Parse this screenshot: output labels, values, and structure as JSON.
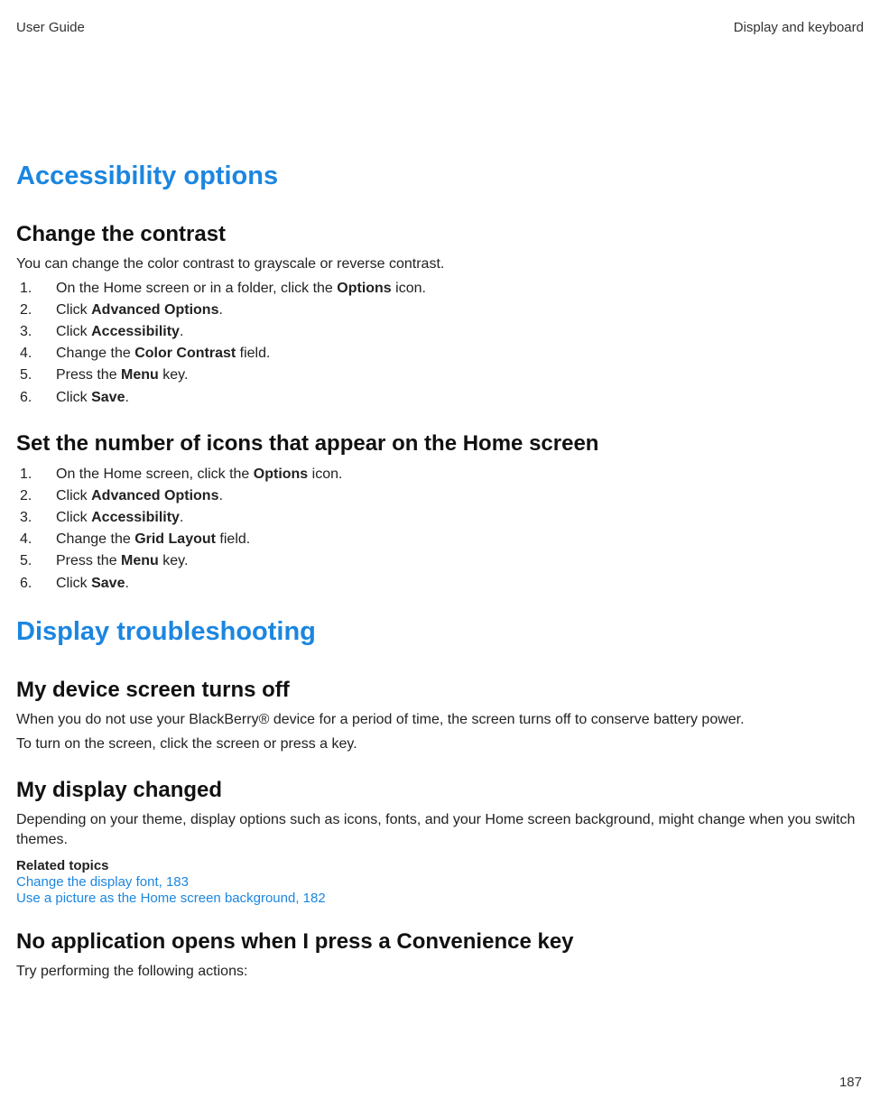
{
  "header": {
    "left": "User Guide",
    "right": "Display and keyboard"
  },
  "section1": {
    "title": "Accessibility options",
    "sub1": {
      "title": "Change the contrast",
      "intro": "You can change the color contrast to grayscale or reverse contrast.",
      "steps": {
        "s1a": "On the Home screen or in a folder, click the ",
        "s1b": "Options",
        "s1c": " icon.",
        "s2a": "Click ",
        "s2b": "Advanced Options",
        "s2c": ".",
        "s3a": "Click ",
        "s3b": "Accessibility",
        "s3c": ".",
        "s4a": "Change the ",
        "s4b": "Color Contrast",
        "s4c": " field.",
        "s5a": "Press the ",
        "s5b": "Menu",
        "s5c": " key.",
        "s6a": "Click ",
        "s6b": "Save",
        "s6c": "."
      }
    },
    "sub2": {
      "title": "Set the number of icons that appear on the Home screen",
      "steps": {
        "s1a": "On the Home screen, click the ",
        "s1b": "Options",
        "s1c": " icon.",
        "s2a": "Click ",
        "s2b": "Advanced Options",
        "s2c": ".",
        "s3a": "Click ",
        "s3b": "Accessibility",
        "s3c": ".",
        "s4a": "Change the ",
        "s4b": "Grid Layout",
        "s4c": " field.",
        "s5a": "Press the ",
        "s5b": "Menu",
        "s5c": " key.",
        "s6a": "Click ",
        "s6b": "Save",
        "s6c": "."
      }
    }
  },
  "section2": {
    "title": "Display troubleshooting",
    "sub1": {
      "title": "My device screen turns off",
      "p1": "When you do not use your BlackBerry® device for a period of time, the screen turns off to conserve battery power.",
      "p2": "To turn on the screen, click the screen or press a key."
    },
    "sub2": {
      "title": "My display changed",
      "p1": "Depending on your theme, display options such as icons, fonts, and your Home screen background, might change when you switch themes.",
      "related_label": "Related topics",
      "link1": "Change the display font, 183",
      "link2": "Use a picture as the Home screen background, 182"
    },
    "sub3": {
      "title": "No application opens when I press a Convenience key",
      "p1": "Try performing the following actions:"
    }
  },
  "page_number": "187"
}
